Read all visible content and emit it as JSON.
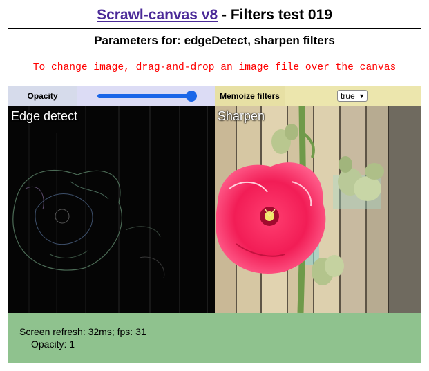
{
  "header": {
    "title_link": "Scrawl-canvas v8",
    "title_rest": " - Filters test 019"
  },
  "subtitle": "Parameters for: edgeDetect, sharpen filters",
  "instruction": "To change image, drag-and-drop an image file over the canvas",
  "controls": {
    "opacity_label": "Opacity",
    "opacity_value": 1,
    "memoize_label": "Memoize filters",
    "memoize_selected": "true"
  },
  "canvas": {
    "left_label": "Edge detect",
    "right_label": "Sharpen"
  },
  "status": {
    "refresh_line": "Screen refresh: 32ms; fps: 31",
    "opacity_line": "Opacity: 1"
  },
  "colors": {
    "link": "#4b2a98",
    "instruction": "#ff0000",
    "slider": "#1a66e8",
    "status_bg": "#8fc28e"
  }
}
